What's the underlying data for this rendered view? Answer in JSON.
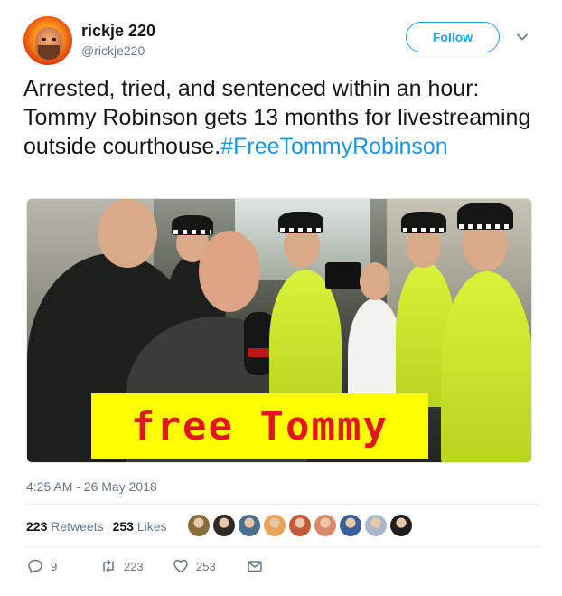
{
  "header": {
    "display_name": "rickje 220",
    "screen_name": "@rickje220",
    "follow_label": "Follow",
    "caret_icon": "chevron-down-icon"
  },
  "tweet": {
    "text": "Arrested, tried, and sentenced within an hour: Tommy Robinson gets 13 months for livestreaming outside courthouse.",
    "hashtag": "#FreeTommyRobinson"
  },
  "media": {
    "banner_text": "free Tommy",
    "banner_bg": "#ffff00",
    "banner_fg": "#e2161d"
  },
  "timestamp": "4:25 AM - 26 May 2018",
  "stats": {
    "retweets_count": "223",
    "retweets_label": "Retweets",
    "likes_count": "253",
    "likes_label": "Likes",
    "liker_avatar_colors": [
      "#8a6d3b",
      "#2f2a26",
      "#4a6f8f",
      "#e7a45b",
      "#c45a3a",
      "#d9896b",
      "#3b5f9a",
      "#aab8c9",
      "#1f1f1f"
    ]
  },
  "actions": {
    "reply_icon": "reply-icon",
    "reply_count": "9",
    "retweet_icon": "retweet-icon",
    "retweet_count": "223",
    "like_icon": "heart-icon",
    "like_count": "253",
    "dm_icon": "envelope-icon"
  },
  "colors": {
    "link_blue": "#1b95e0",
    "follow_blue": "#1da1f2",
    "muted": "#657786"
  }
}
